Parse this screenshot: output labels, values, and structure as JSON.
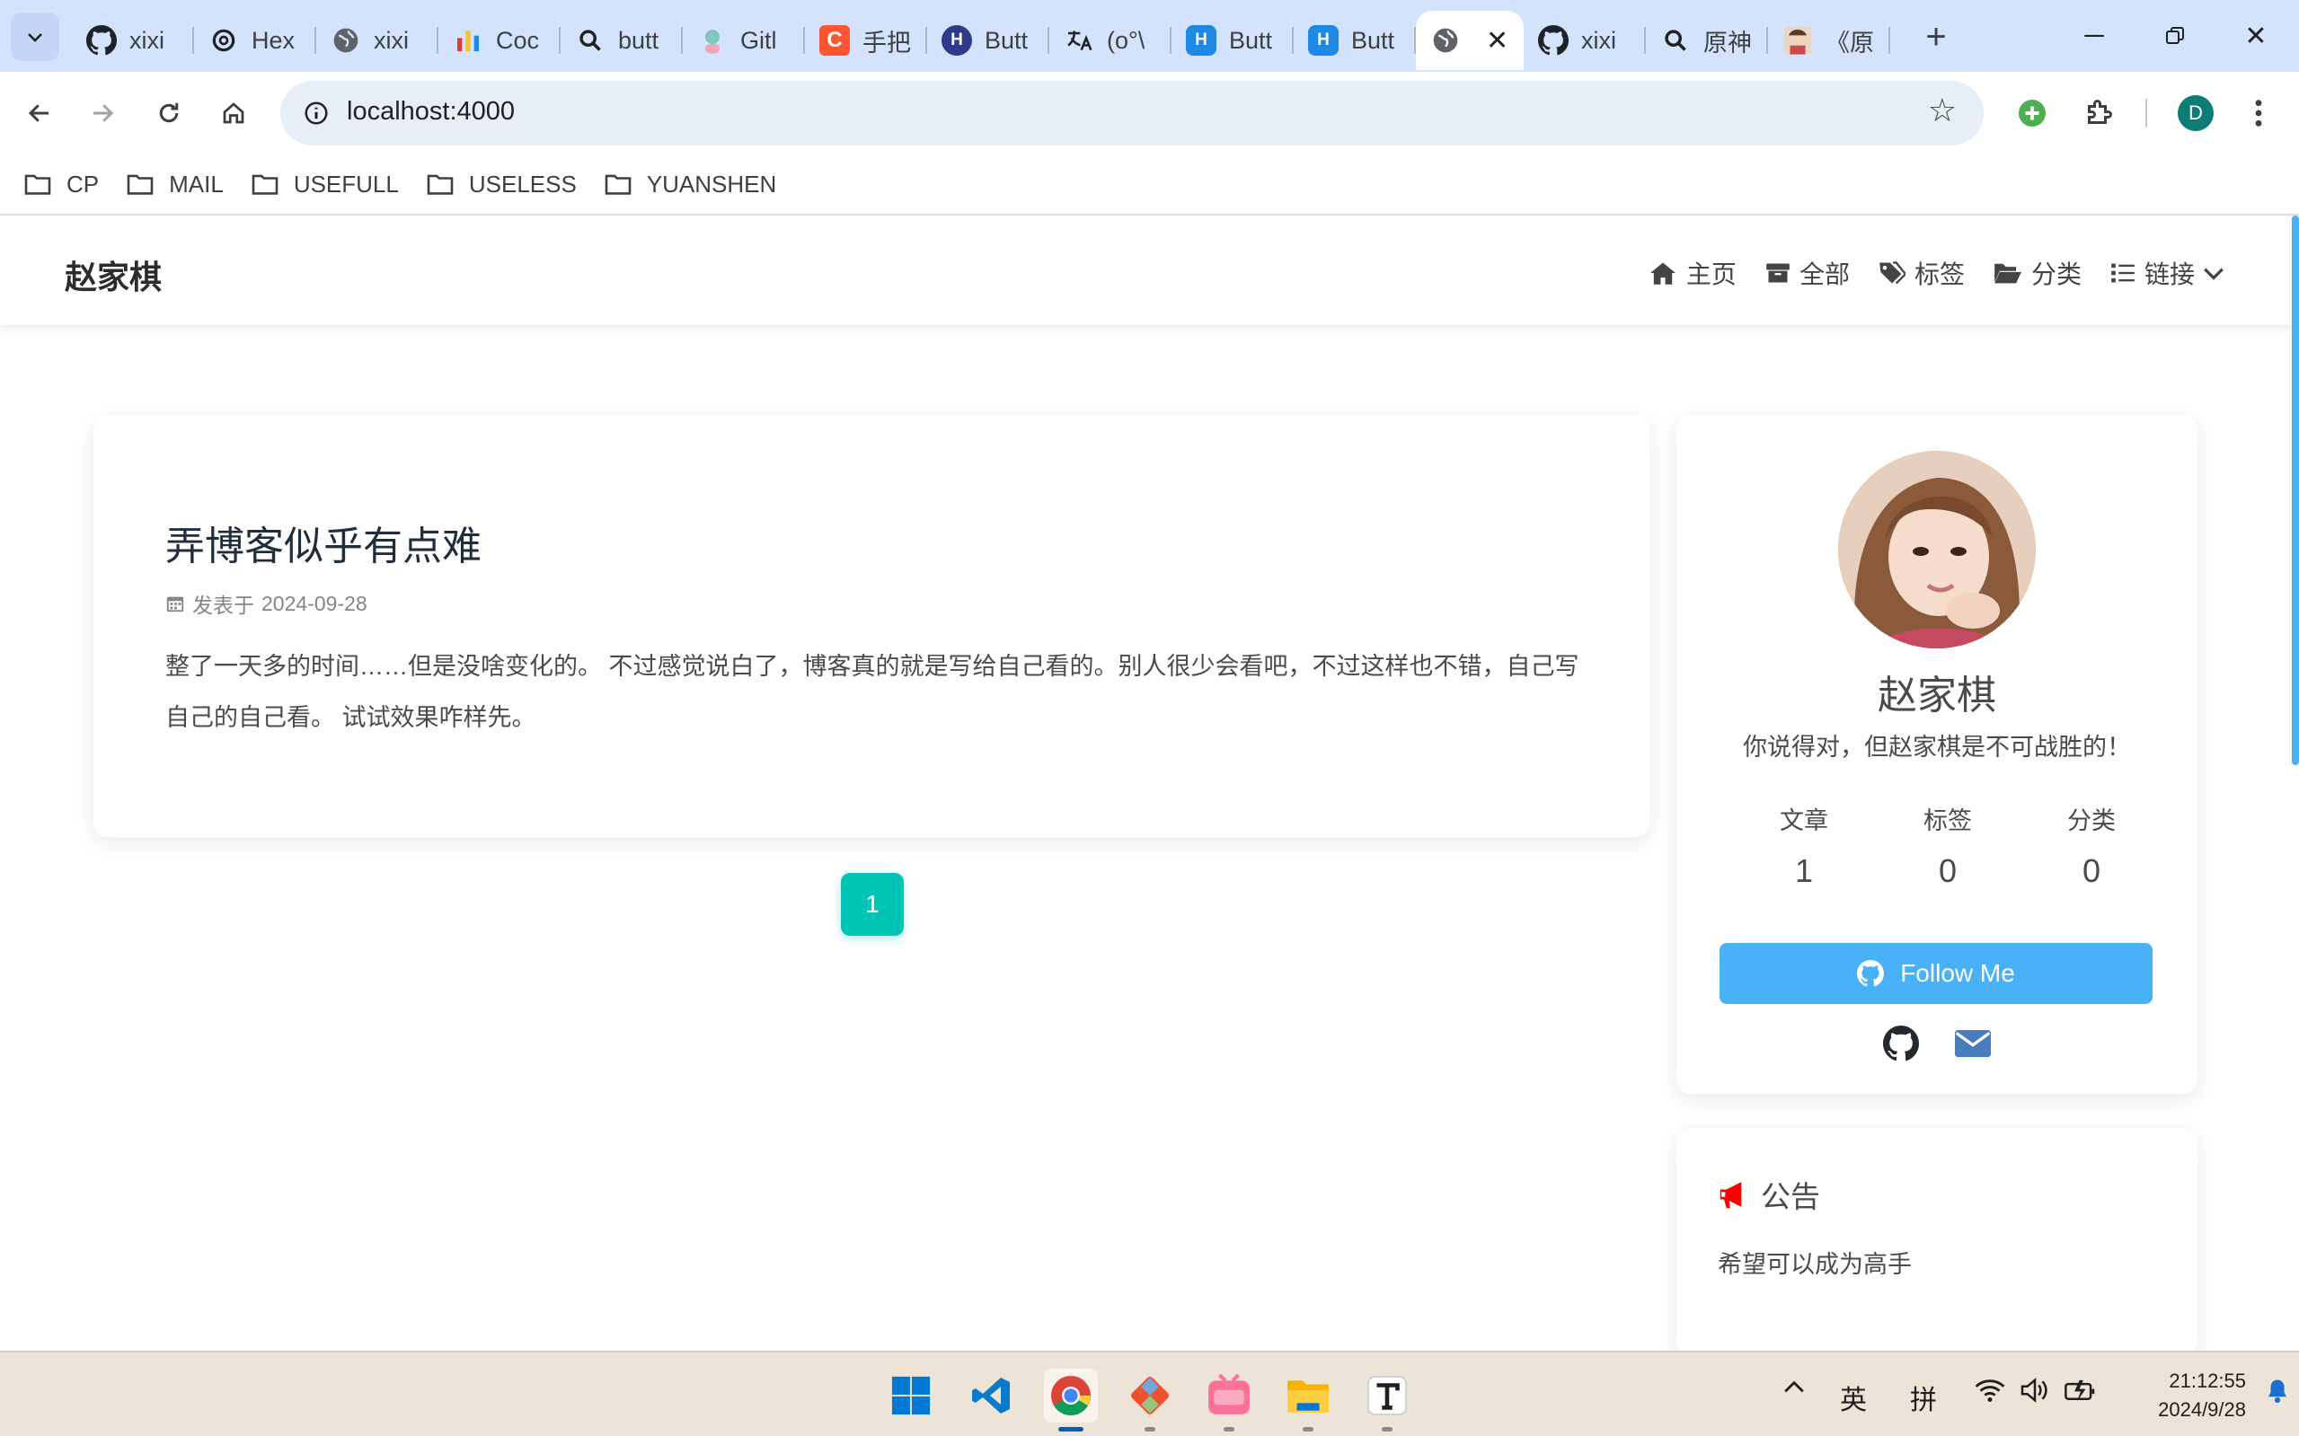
{
  "browser": {
    "tabs": [
      {
        "title": "xixi",
        "icon": "github-icon",
        "active": false
      },
      {
        "title": "Hex",
        "icon": "openai-icon",
        "active": false
      },
      {
        "title": "xixi",
        "icon": "globe-icon",
        "active": false
      },
      {
        "title": "Coc",
        "icon": "chart-icon",
        "active": false
      },
      {
        "title": "butt",
        "icon": "search-icon",
        "active": false
      },
      {
        "title": "Gitl",
        "icon": "avatar-icon",
        "active": false
      },
      {
        "title": "手把",
        "icon": "csdn-icon",
        "active": false
      },
      {
        "title": "Butt",
        "icon": "h-icon",
        "active": false
      },
      {
        "title": "(o°\\",
        "icon": "translate-icon",
        "active": false
      },
      {
        "title": "Butt",
        "icon": "h-hex-icon",
        "active": false
      },
      {
        "title": "Butt",
        "icon": "h-hex-icon",
        "active": false
      },
      {
        "title": "",
        "icon": "globe-icon",
        "active": true
      },
      {
        "title": "xixi",
        "icon": "github-icon",
        "active": false
      },
      {
        "title": "原神",
        "icon": "search-icon",
        "active": false
      },
      {
        "title": "《原",
        "icon": "anime-icon",
        "active": false
      }
    ],
    "url": "localhost:4000",
    "profile_initial": "D",
    "bookmarks": [
      "CP",
      "MAIL",
      "USEFULL",
      "USELESS",
      "YUANSHEN"
    ]
  },
  "site": {
    "brand": "赵家棋",
    "menu": [
      {
        "label": "主页",
        "icon": "home-icon"
      },
      {
        "label": "全部",
        "icon": "archive-icon"
      },
      {
        "label": "标签",
        "icon": "tags-icon"
      },
      {
        "label": "分类",
        "icon": "folder-open-icon"
      },
      {
        "label": "链接",
        "icon": "list-icon"
      }
    ]
  },
  "post": {
    "title": "弄博客似乎有点难",
    "meta_label": "发表于",
    "date": "2024-09-28",
    "excerpt": "整了一天多的时间……但是没啥变化的。 不过感觉说白了，博客真的就是写给自己看的。别人很少会看吧，不过这样也不错，自己写自己的自己看。 试试效果咋样先。"
  },
  "pagination": {
    "current": "1"
  },
  "author": {
    "name": "赵家棋",
    "description": "你说得对，但赵家棋是不可战胜的！",
    "stats": [
      {
        "label": "文章",
        "value": "1"
      },
      {
        "label": "标签",
        "value": "0"
      },
      {
        "label": "分类",
        "value": "0"
      }
    ],
    "follow_label": "Follow Me"
  },
  "announcement": {
    "title": "公告",
    "text": "希望可以成为高手"
  },
  "taskbar": {
    "apps": [
      "start",
      "vscode",
      "chrome",
      "git",
      "bilibili",
      "file-explorer",
      "typora"
    ],
    "ime_lang": "英",
    "ime_mode": "拼",
    "time": "21:12:55",
    "date": "2024/9/28"
  },
  "colors": {
    "accent_blue": "#49b1f5",
    "pagination_teal": "#00c4b6",
    "tabstrip": "#d3e3fd",
    "taskbar": "#ede3d6"
  }
}
